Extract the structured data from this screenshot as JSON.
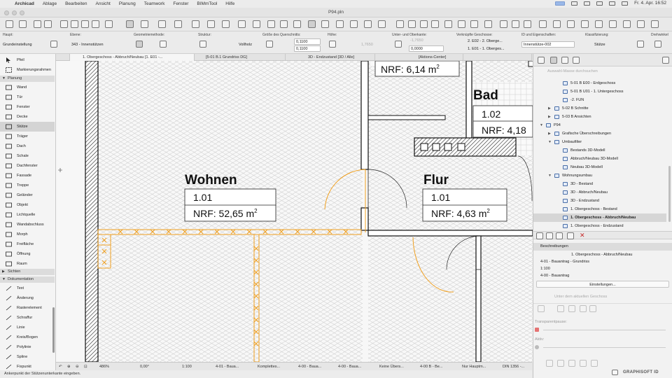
{
  "menubar": {
    "apple": "",
    "items": [
      "Archicad",
      "Ablage",
      "Bearbeiten",
      "Ansicht",
      "Planung",
      "Teamwork",
      "Fenster",
      "BIMmTool",
      "Hilfe"
    ],
    "datetime": "Fr. 4. Apr.  16:52"
  },
  "window": {
    "title": "P94.pln"
  },
  "infobox": {
    "haupt_label": "Haupt:",
    "haupt_value": "Grundeinstellung",
    "ebene_label": "Ebene:",
    "ebene_value": "343 - Innenstützen",
    "geometrie_label": "Geometriemethode:",
    "struktur_label": "Struktur:",
    "struktur_value": "Vollholz",
    "querschnitt_label": "Größe des Querschnitts:",
    "querschnitt_a": "0,1100",
    "querschnitt_b": "0,1100",
    "hoehe_label": "Höhe:",
    "hoehe_value": "1,7650",
    "kanten_label": "Unter- und Oberkante:",
    "kante_value": "0,0000",
    "kante_top": "-1,7650",
    "geschosse_label": "Verknüpfte Geschosse:",
    "geschoss_1": "2. E02 - 2. Oberge...",
    "geschoss_2": "1. E01 - 1. Oberges...",
    "id_label": "ID und Eigenschaften:",
    "id_value": "Innenstütze-002",
    "klass_label": "Klassifizierung:",
    "klass_value": "Stütze",
    "dreh_label": "Drehwinkel"
  },
  "tabs": [
    "1. Obergeschoss - Abbruch/Neubau [1. E01 -...",
    "[5-01 B.1 Grundriss DG]",
    "3D - Endzustand [3D / Alle]",
    "[Aktions-Center]"
  ],
  "toolbox": {
    "pfeil": "Pfeil",
    "markierung": "Markierungsrahmen",
    "group_planung": "Planung",
    "planung": [
      "Wand",
      "Tür",
      "Fenster",
      "Decke",
      "Stütze",
      "Träger",
      "Dach",
      "Schale",
      "Dachfenster",
      "Fassade",
      "Treppe",
      "Geländer",
      "Objekt",
      "Lichtquelle",
      "Wandabschluss",
      "Morph",
      "Freifläche",
      "Öffnung",
      "Raum"
    ],
    "group_sichten": "Sichten",
    "group_dokumentation": "Dokumentation",
    "dokumentation": [
      "Text",
      "Änderung",
      "Rasterelement",
      "Schraffur",
      "Linie",
      "Kreis/Bogen",
      "Polylinie",
      "Spline",
      "Fixpunkt"
    ]
  },
  "rooms": [
    {
      "name": "",
      "number": "",
      "area": "NRF: 6,14 m",
      "sup": "2"
    },
    {
      "name": "Bad",
      "number": "1.02",
      "area": "NRF: 4,18",
      "sup": ""
    },
    {
      "name": "Wohnen",
      "number": "1.01",
      "area": "NRF: 52,65 m",
      "sup": "2"
    },
    {
      "name": "Flur",
      "number": "1.01",
      "area": "NRF: 4,63 m",
      "sup": "2"
    }
  ],
  "statusbar": {
    "zoom": "486%",
    "angle": "0,00°",
    "scale": "1:100",
    "s1": "4-01 - Baua...",
    "s2": "Komplettes...",
    "s3": "4-00 - Baua...",
    "s4": "4-00 - Baua...",
    "s5": "Keine Übers...",
    "s6": "4-00 B - Be...",
    "s7": "Nur Hauptm...",
    "s8": "DIN 1356 -..."
  },
  "hint": "Ankerpunkt der Stützenunterkante eingeben.",
  "navigator": {
    "search_placeholder": "Auswahl-Masse durchsuchen",
    "rows": [
      "5-01 B E00 - Erdgeschoss",
      "5-01 B U01 - 1. Untergeschoss",
      "-2. FUN",
      "5-02 B Schnitte",
      "5-03 B Ansichten",
      "P94",
      "Grafische Überschreibungen",
      "Umbaufilter",
      "Bestands 3D-Modell",
      "Abbruch/Neubau 3D-Modell",
      "Neubau 3D-Modell",
      "Wohnungsumbau",
      "3D - Bestand",
      "3D - Abbruch/Neubau",
      "3D - Endzustand",
      "1. Obergeschoss - Bestand",
      "1. Obergeschoss - Abbruch/Neubau",
      "1. Obergeschoss - Endzustand"
    ],
    "beschreibungen_label": "Beschreibungen",
    "beschreibung_title": "1. Obergeschoss - Abbruch/Neubau",
    "b1": "4-01 - Bauantrag - Grundriss",
    "b2": "1:100",
    "b3": "4-00 - Bauantrag",
    "settings_button": "Einstellungen...",
    "unter_geschoss": "Unter dem aktuellen Geschoss",
    "transparent_label": "Transparentpause:",
    "aktiv_label": "Aktiv:",
    "brand": "GRAPHISOFT ID"
  },
  "colors": {
    "accent": "#f0a020",
    "selection": "#d4d4d4",
    "wall": "#1a1a1a"
  }
}
